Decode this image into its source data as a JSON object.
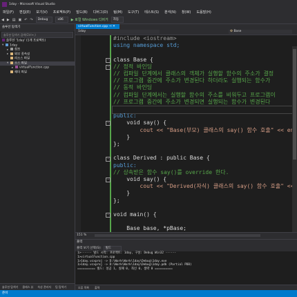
{
  "window": {
    "title": "1day - Microsoft Visual Studio"
  },
  "menu": [
    "파일(F)",
    "편집(E)",
    "보기(V)",
    "프로젝트(P)",
    "빌드(B)",
    "디버그(D)",
    "팀(M)",
    "도구(T)",
    "테스트(S)",
    "분석(N)",
    "창(W)",
    "도움말(H)"
  ],
  "toolbar": {
    "config": "Debug",
    "platform": "x86",
    "run_label": "▶ 로컬 Windows 디버거",
    "auto": "자동"
  },
  "solution_explorer": {
    "title": "솔루션 탐색기",
    "search_placeholder": "솔루션 탐색기 검색(Ctrl+;)",
    "items": [
      {
        "label": "솔루션 '1day' (1개 프로젝트)"
      },
      {
        "label": "1day"
      },
      {
        "label": "참조"
      },
      {
        "label": "외부 종속성"
      },
      {
        "label": "리소스 파일"
      },
      {
        "label": "소스 파일"
      },
      {
        "label": "virtualFunction.cpp"
      },
      {
        "label": "헤더 파일"
      }
    ],
    "bottom_tabs": [
      "솔루션 탐색기",
      "클래스 뷰",
      "속성 관리자",
      "팀 탐색기"
    ]
  },
  "editor": {
    "tab": "virtualFunction.cpp",
    "nav_left": "1day",
    "nav_right": "Base",
    "lines": [
      "#include <iostream>",
      "using namespace std;",
      "",
      "class Base {",
      "// 정적 바인딩",
      "// 컴파일 단계에서 클래스의 객체가 실행할 함수의 주소가 결정",
      "// 프로그램 중간에 주소가 변경된다 하더라도 실행되는 함수가",
      "// 동적 바인딩",
      "// 컴파일 단계에서는 실행할 함수의 주소를 비워두고 프로그램이",
      "// 프로그램 중간에 주소가 변경되면 실행되는 함수가 변경된다",
      "",
      "public:",
      "    void say() {",
      "        cout << \"Base(부모) 클래스의 say() 함수 호출\" << endl",
      "    }",
      "};",
      "",
      "class Derived : public Base {",
      "public:",
      "// 상속받은 함수 say()를 override 한다.",
      "    void say() {",
      "        cout << \"Derived(자식) 클래스의 say() 함수 호출\" << e",
      "    }",
      "};",
      "",
      "void main() {",
      "",
      "    Base base, *pBase;"
    ],
    "zoom": "151 %"
  },
  "output": {
    "title": "출력",
    "source_label": "출력 보기 선택(S):",
    "source_value": "빌드",
    "lines": [
      "1>------ 빌드 시작: 프로젝트: 1day, 구성: Debug Win32 ------",
      "1>virtualFunction.cpp",
      "1>1day.vcxproj -> D:\\Work\\Work\\1day\\Debug\\1day.exe",
      "1>1day.vcxproj -> D:\\Work\\Work\\1day\\Debug\\1day.pdb (Partial PDB)",
      "========== 빌드: 성공 1, 실패 0, 최신 0, 생략 0 =========="
    ],
    "bottom_tabs": [
      "오류 목록",
      "출력"
    ]
  },
  "status": {
    "text": "준비"
  },
  "colors": {
    "accent": "#007acc",
    "keyword": "#569cd6",
    "comment": "#57a64a",
    "string": "#d69d85"
  }
}
